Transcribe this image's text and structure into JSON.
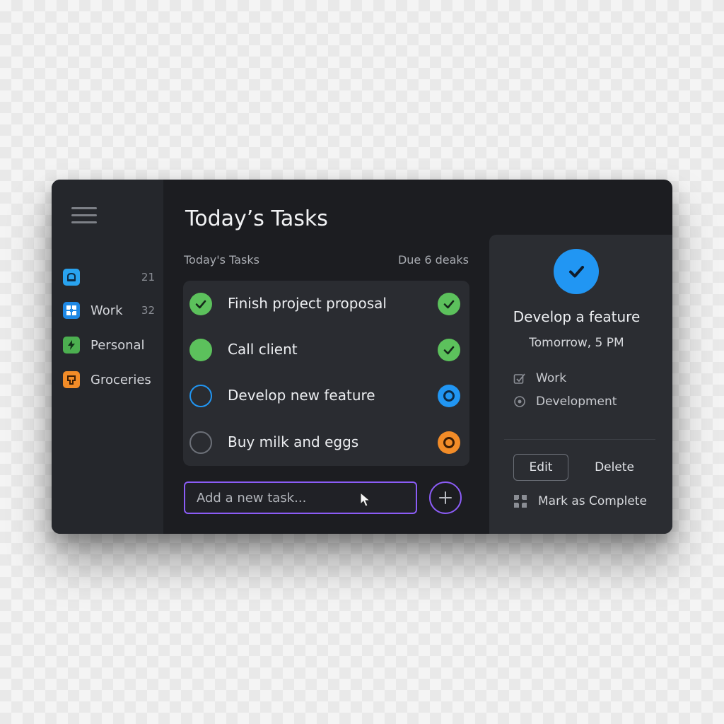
{
  "header": {
    "title": "Today’s Tasks"
  },
  "sidebar": {
    "items": [
      {
        "label": "",
        "count": "21",
        "icon": "inbox-icon",
        "color": "#29a3f0"
      },
      {
        "label": "Work",
        "count": "32",
        "icon": "work-grid-icon",
        "color": "#1e88e5"
      },
      {
        "label": "Personal",
        "count": "",
        "icon": "lightning-icon",
        "color": "#4caf50"
      },
      {
        "label": "Groceries",
        "count": "",
        "icon": "basket-icon",
        "color": "#f28c28"
      }
    ]
  },
  "list": {
    "header": "Today's Tasks",
    "due_label": "Due 6 deaks",
    "tasks": [
      {
        "label": "Finish project proposal",
        "check_state": "checked",
        "status": "done",
        "status_color": "#5cc15c"
      },
      {
        "label": "Call client",
        "check_state": "filled",
        "status": "done",
        "status_color": "#5cc15c"
      },
      {
        "label": "Develop new feature",
        "check_state": "outline-blue",
        "status": "in-progress",
        "status_color": "#2196f3"
      },
      {
        "label": "Buy milk and eggs",
        "check_state": "outline-gray",
        "status": "pending",
        "status_color": "#f28c28"
      }
    ]
  },
  "add_task": {
    "placeholder": "Add a new task..."
  },
  "detail": {
    "title": "Develop a feature",
    "due": "Tomorrow, 5 PM",
    "project": "Work",
    "category": "Development",
    "edit_label": "Edit",
    "delete_label": "Delete",
    "complete_label": "Mark as Complete"
  },
  "colors": {
    "accent_purple": "#8b5cf6",
    "success_green": "#5cc15c",
    "primary_blue": "#2196f3",
    "warning_orange": "#f28c28"
  }
}
